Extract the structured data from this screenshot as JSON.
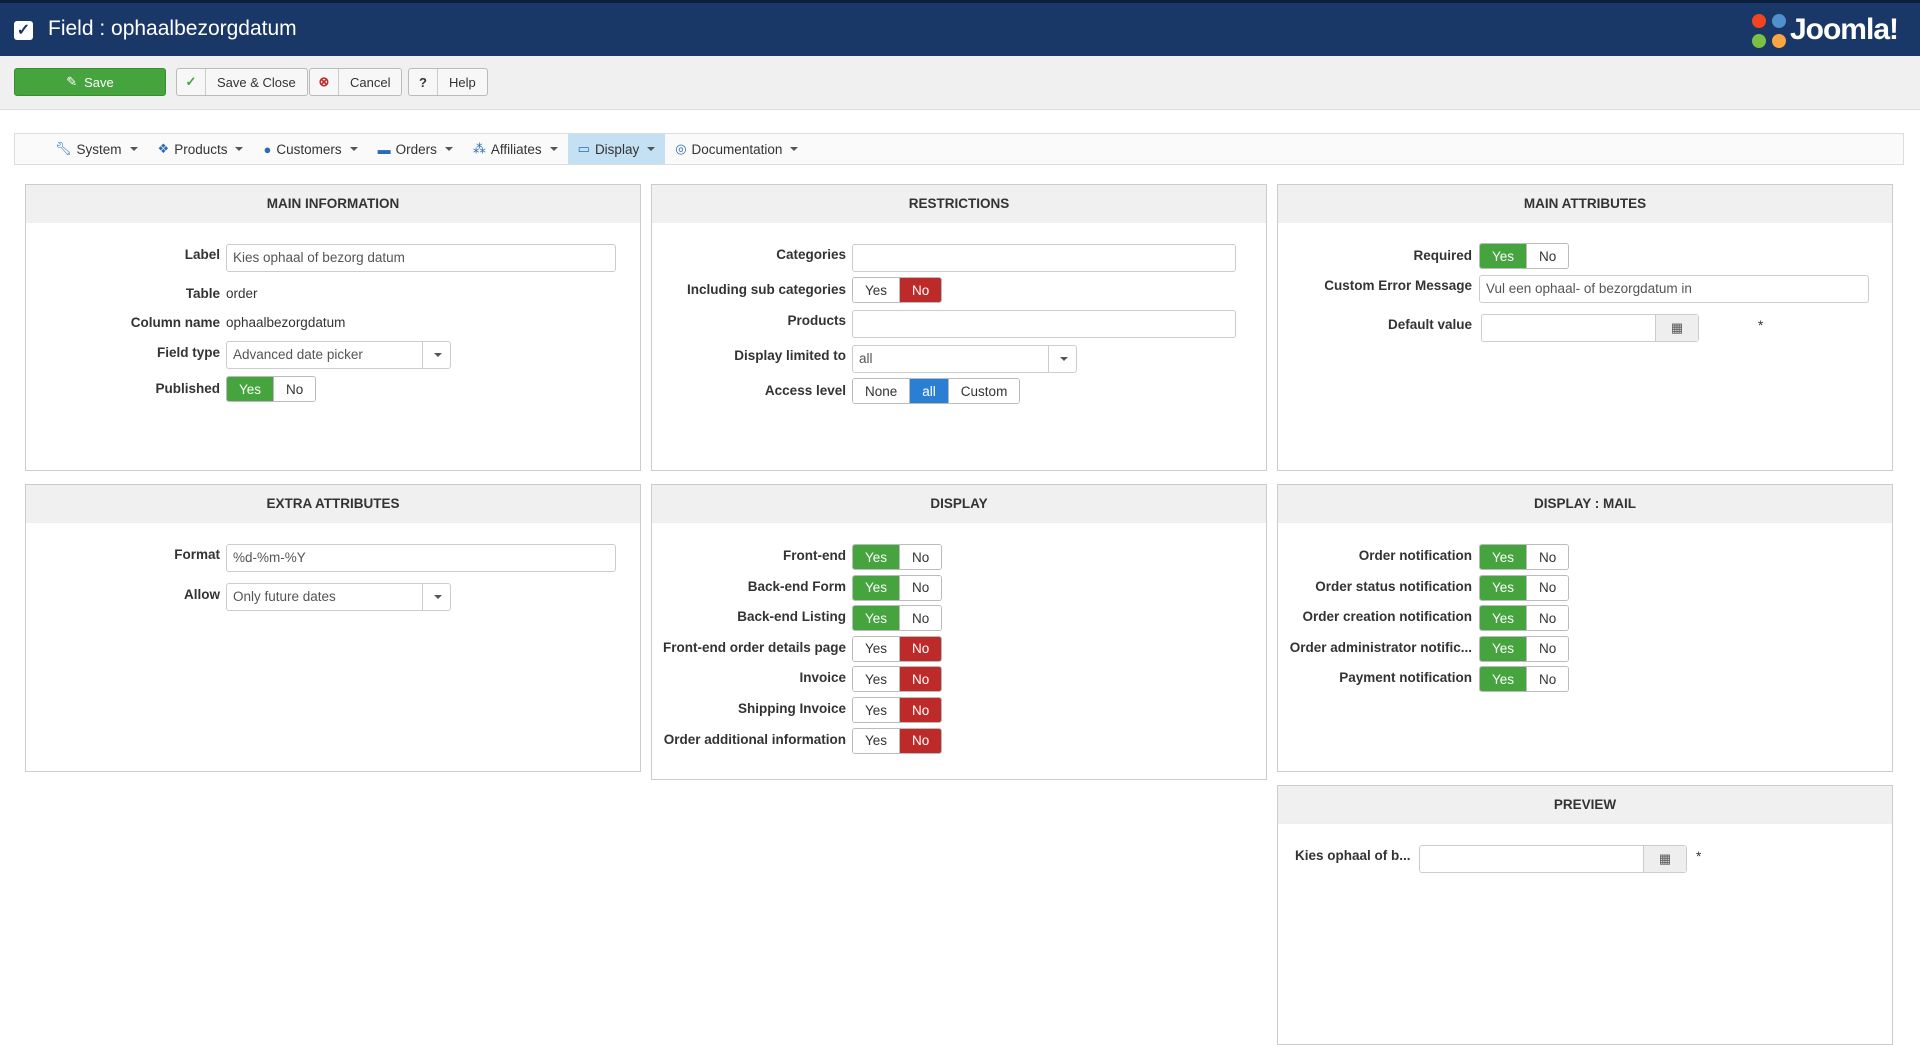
{
  "header": {
    "title": "Field : ophaalbezorgdatum",
    "logo": "Joomla!"
  },
  "toolbar": {
    "save": "Save",
    "save_close": "Save & Close",
    "cancel": "Cancel",
    "help": "Help"
  },
  "menu": [
    {
      "label": "System",
      "icon": "wrench-icon"
    },
    {
      "label": "Products",
      "icon": "cubes-icon"
    },
    {
      "label": "Customers",
      "icon": "user-icon"
    },
    {
      "label": "Orders",
      "icon": "credit-card-icon"
    },
    {
      "label": "Affiliates",
      "icon": "users-icon"
    },
    {
      "label": "Display",
      "icon": "monitor-icon",
      "active": true
    },
    {
      "label": "Documentation",
      "icon": "lifebuoy-icon"
    }
  ],
  "main_info": {
    "title": "MAIN INFORMATION",
    "label_l": "Label",
    "label_v": "Kies ophaal of bezorg datum",
    "table_l": "Table",
    "table_v": "order",
    "column_l": "Column name",
    "column_v": "ophaalbezorgdatum",
    "fieldtype_l": "Field type",
    "fieldtype_v": "Advanced date picker",
    "published_l": "Published",
    "yes": "Yes",
    "no": "No"
  },
  "restrictions": {
    "title": "RESTRICTIONS",
    "categories_l": "Categories",
    "subcat_l": "Including sub categories",
    "products_l": "Products",
    "display_l": "Display limited to",
    "display_v": "all",
    "access_l": "Access level",
    "none": "None",
    "all": "all",
    "custom": "Custom",
    "yes": "Yes",
    "no": "No"
  },
  "main_attr": {
    "title": "MAIN ATTRIBUTES",
    "required_l": "Required",
    "error_l": "Custom Error Message",
    "error_v": "Vul een ophaal- of bezorgdatum in",
    "default_l": "Default value",
    "asterisk": "*",
    "yes": "Yes",
    "no": "No"
  },
  "extra": {
    "title": "EXTRA ATTRIBUTES",
    "format_l": "Format",
    "format_v": "%d-%m-%Y",
    "allow_l": "Allow",
    "allow_v": "Only future dates"
  },
  "display": {
    "title": "DISPLAY",
    "rows": [
      {
        "label": "Front-end",
        "value": "yes"
      },
      {
        "label": "Back-end Form",
        "value": "yes"
      },
      {
        "label": "Back-end Listing",
        "value": "yes"
      },
      {
        "label": "Front-end order details page",
        "value": "no"
      },
      {
        "label": "Invoice",
        "value": "no"
      },
      {
        "label": "Shipping Invoice",
        "value": "no"
      },
      {
        "label": "Order additional information",
        "value": "no"
      }
    ],
    "yes": "Yes",
    "no": "No"
  },
  "display_mail": {
    "title": "DISPLAY : MAIL",
    "rows": [
      {
        "label": "Order notification",
        "value": "yes"
      },
      {
        "label": "Order status notification",
        "value": "yes"
      },
      {
        "label": "Order creation notification",
        "value": "yes"
      },
      {
        "label": "Order administrator notific...",
        "value": "yes"
      },
      {
        "label": "Payment notification",
        "value": "yes"
      }
    ],
    "yes": "Yes",
    "no": "No"
  },
  "preview": {
    "title": "PREVIEW",
    "label": "Kies ophaal of b...",
    "asterisk": "*"
  }
}
